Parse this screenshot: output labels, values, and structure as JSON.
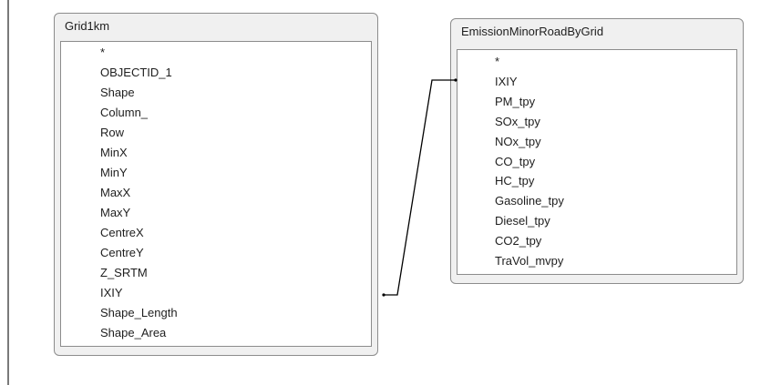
{
  "diagram": {
    "tables": [
      {
        "title": "Grid1km",
        "fields": [
          "*",
          "OBJECTID_1",
          "Shape",
          "Column_",
          "Row",
          "MinX",
          "MinY",
          "MaxX",
          "MaxY",
          "CentreX",
          "CentreY",
          "Z_SRTM",
          "IXIY",
          "Shape_Length",
          "Shape_Area"
        ]
      },
      {
        "title": "EmissionMinorRoadByGrid",
        "fields": [
          "*",
          "IXIY",
          "PM_tpy",
          "SOx_tpy",
          "NOx_tpy",
          "CO_tpy",
          "HC_tpy",
          "Gasoline_tpy",
          "Diesel_tpy",
          "CO2_tpy",
          "TraVol_mvpy"
        ]
      }
    ],
    "relationship": {
      "from_table": "Grid1km",
      "from_field": "IXIY",
      "to_table": "EmissionMinorRoadByGrid",
      "to_field": "IXIY"
    }
  },
  "colors": {
    "window_bg": "#f0f0f0",
    "window_border": "#8c8c8c",
    "list_bg": "#ffffff",
    "line": "#000000"
  }
}
